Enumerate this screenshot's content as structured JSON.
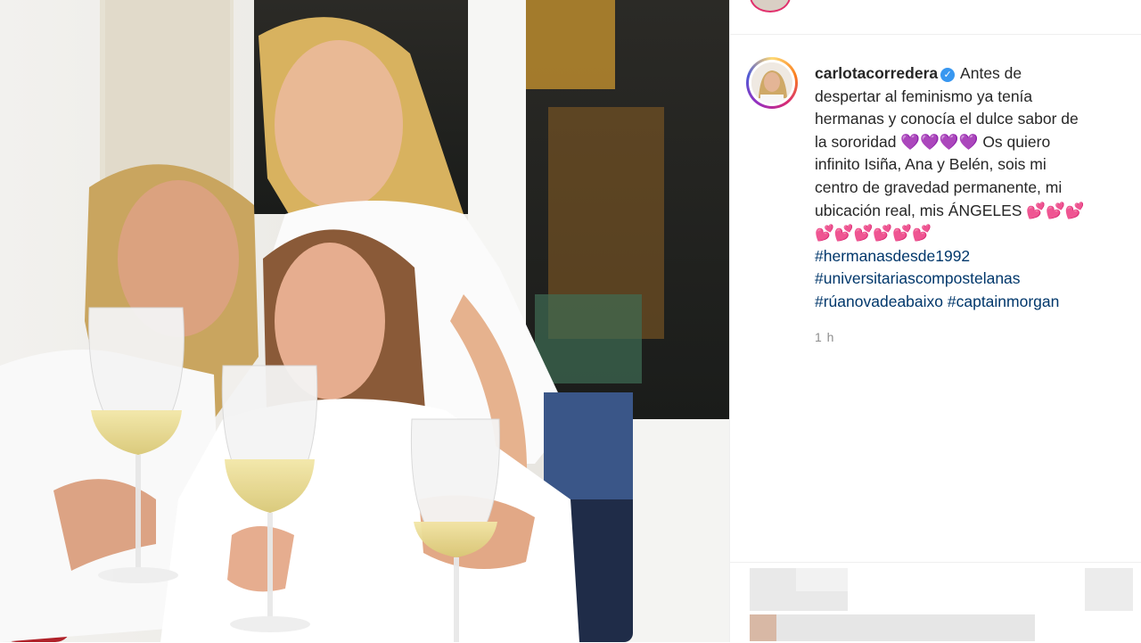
{
  "post": {
    "username": "carlotacorredera",
    "caption_lines": [
      "Antes de",
      "despertar al feminismo ya tenía",
      "hermanas y conocía el dulce sabor de",
      "la sororidad 💜💜💜💜 Os quiero",
      "infinito Isiña, Ana y Belén, sois mi",
      "centro de gravedad permanente, mi",
      "ubicación real, mis ÁNGELES 💕💕💕",
      "💕💕💕💕💕💕"
    ],
    "hashtags": [
      "#hermanasdesde1992",
      "#universitariascompostelanas",
      "#rúanovadeabaixo #captainmorgan"
    ],
    "timestamp": "1 h"
  },
  "icons": {
    "verified": "verified-badge-icon"
  },
  "colors": {
    "hashtag": "#00376b",
    "verified": "#3897f0",
    "muted": "#8e8e8e"
  }
}
